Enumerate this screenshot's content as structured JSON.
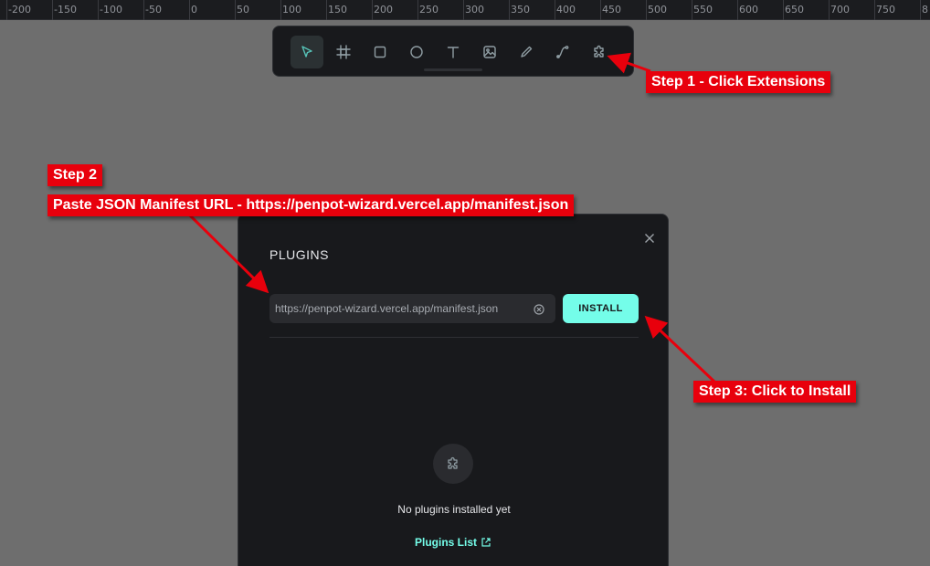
{
  "ruler": {
    "labels": [
      "-200",
      "-150",
      "-100",
      "-50",
      "0",
      "50",
      "100",
      "150",
      "200",
      "250",
      "300",
      "350",
      "400",
      "450",
      "500",
      "550",
      "600",
      "650",
      "700",
      "750",
      "8"
    ]
  },
  "toolbar": {
    "tools": [
      {
        "icon": "pointer-icon",
        "active": true
      },
      {
        "icon": "board-icon",
        "active": false
      },
      {
        "icon": "rectangle-icon",
        "active": false
      },
      {
        "icon": "ellipse-icon",
        "active": false
      },
      {
        "icon": "text-icon",
        "active": false
      },
      {
        "icon": "image-icon",
        "active": false
      },
      {
        "icon": "pencil-icon",
        "active": false
      },
      {
        "icon": "path-icon",
        "active": false
      },
      {
        "icon": "puzzle-icon",
        "active": false
      }
    ]
  },
  "modal": {
    "title": "PLUGINS",
    "close_icon": "close-icon",
    "url_value": "https://penpot-wizard.vercel.app/manifest.json",
    "install_label": "INSTALL",
    "empty_text": "No plugins installed yet",
    "plugins_link_label": "Plugins List"
  },
  "annotations": {
    "step1": "Step 1 - Click Extensions",
    "step2_title": "Step 2",
    "step2_text": "Paste JSON Manifest URL - https://penpot-wizard.vercel.app/manifest.json",
    "step3": "Step 3: Click to Install"
  },
  "colors": {
    "canvas": "#6e6e6e",
    "panel": "#18191c",
    "accent": "#74fde9",
    "annotation": "#e8000c"
  }
}
